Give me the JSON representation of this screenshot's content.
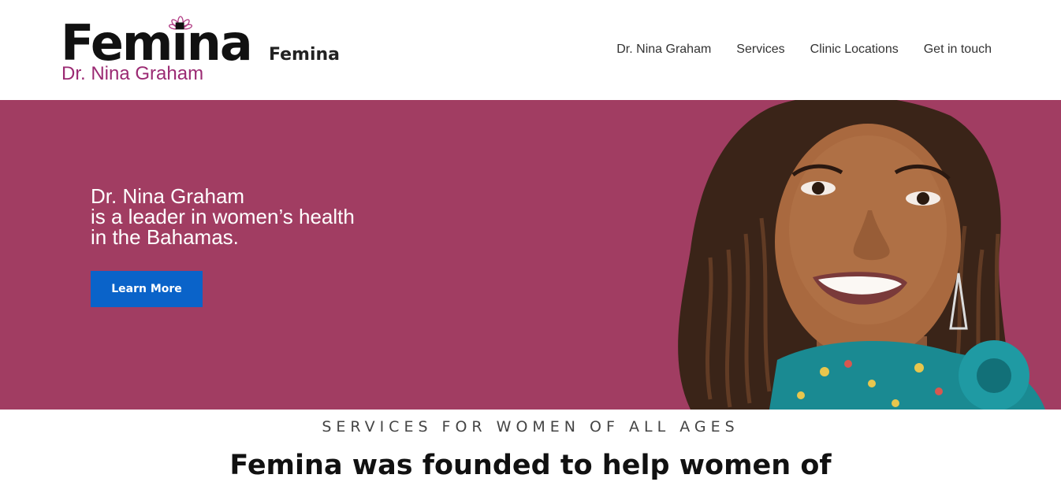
{
  "header": {
    "logo": {
      "word": "Femina",
      "subtitle": "Dr. Nina Graham",
      "accent_color": "#9b2a73",
      "icon": "lotus-icon"
    },
    "site_name": "Femina",
    "nav": [
      {
        "label": "Dr. Nina Graham"
      },
      {
        "label": "Services"
      },
      {
        "label": "Clinic Locations"
      },
      {
        "label": "Get in touch"
      }
    ]
  },
  "hero": {
    "background_color": "#a13d62",
    "lines": [
      "Dr. Nina Graham",
      "is a leader in women’s health",
      "in the Bahamas."
    ],
    "cta_label": "Learn More",
    "cta_color": "#0a63c9"
  },
  "section": {
    "eyebrow": "SERVICES FOR WOMEN OF ALL AGES",
    "heading": "Femina was founded to help women of"
  }
}
